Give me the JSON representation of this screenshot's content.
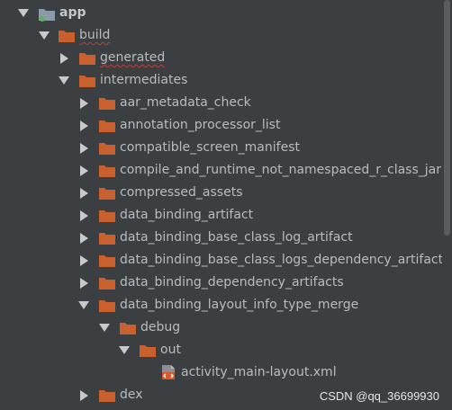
{
  "tree": {
    "root": {
      "label": "app"
    },
    "build": {
      "label": "build"
    },
    "generated": {
      "label": "generated"
    },
    "intermediates": {
      "label": "intermediates"
    },
    "intermediate_items": [
      {
        "label": "aar_metadata_check"
      },
      {
        "label": "annotation_processor_list"
      },
      {
        "label": "compatible_screen_manifest"
      },
      {
        "label": "compile_and_runtime_not_namespaced_r_class_jar"
      },
      {
        "label": "compressed_assets"
      },
      {
        "label": "data_binding_artifact"
      },
      {
        "label": "data_binding_base_class_log_artifact"
      },
      {
        "label": "data_binding_base_class_logs_dependency_artifacts"
      },
      {
        "label": "data_binding_dependency_artifacts"
      },
      {
        "label": "data_binding_layout_info_type_merge"
      }
    ],
    "debug": {
      "label": "debug"
    },
    "out": {
      "label": "out"
    },
    "file": {
      "label": "activity_main-layout.xml"
    },
    "dex": {
      "label": "dex"
    }
  },
  "colors": {
    "background": "#3c3f41",
    "folder": "#c9612f",
    "text": "#bbbbbb",
    "arrow": "#c7c9cc"
  },
  "watermark": "CSDN @qq_36699930"
}
